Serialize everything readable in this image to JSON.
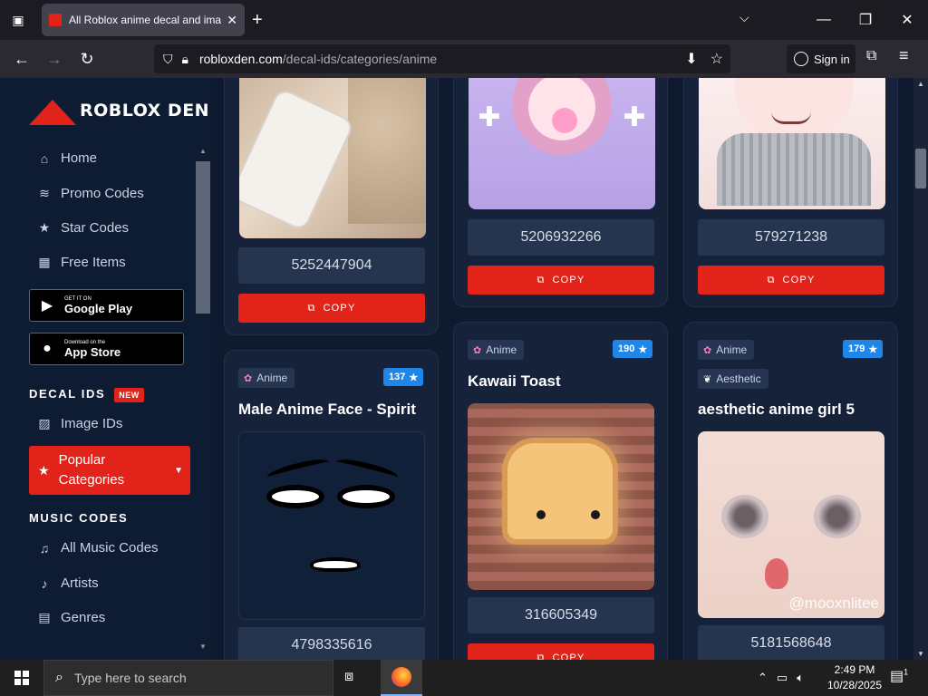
{
  "browser": {
    "tab_title": "All Roblox anime decal and ima",
    "url_domain": "robloxden.com",
    "url_path": "/decal-ids/categories/anime",
    "signin_label": "Sign in"
  },
  "sidebar": {
    "logo_text": "ROBLOX DEN",
    "items": [
      {
        "label": "Home",
        "icon": "home-icon"
      },
      {
        "label": "Promo Codes",
        "icon": "coins-icon"
      },
      {
        "label": "Star Codes",
        "icon": "star-icon"
      },
      {
        "label": "Free Items",
        "icon": "items-icon"
      }
    ],
    "google_play": {
      "small": "GET IT ON",
      "big": "Google Play"
    },
    "app_store": {
      "small": "Download on the",
      "big": "App Store"
    },
    "decal_heading": "DECAL IDS",
    "new_badge": "NEW",
    "image_ids": "Image IDs",
    "popular_categories": "Popular Categories",
    "music_heading": "MUSIC CODES",
    "music_items": [
      {
        "label": "All Music Codes",
        "icon": "music-icon"
      },
      {
        "label": "Artists",
        "icon": "artists-icon"
      },
      {
        "label": "Genres",
        "icon": "genres-icon"
      }
    ]
  },
  "cards": [
    {
      "id": "5252447904",
      "copy": "COPY"
    },
    {
      "id": "5206932266",
      "copy": "COPY"
    },
    {
      "id": "579271238",
      "copy": "COPY"
    },
    {
      "tag": "Anime",
      "likes": "137",
      "title": "Male Anime Face - Spirit",
      "id": "4798335616"
    },
    {
      "tag": "Anime",
      "likes": "190",
      "title": "Kawaii Toast",
      "id": "316605349",
      "copy": "COPY"
    },
    {
      "tag": "Anime",
      "tag2": "Aesthetic",
      "likes": "179",
      "title": "aesthetic anime girl 5",
      "id": "5181568648",
      "watermark": "@mooxnlitee"
    }
  ],
  "taskbar": {
    "search_placeholder": "Type here to search",
    "time": "2:49 PM",
    "date": "10/28/2025",
    "notifications": "1"
  },
  "colors": {
    "accent_red": "#e2231a",
    "likes_blue": "#1f86e8",
    "bg": "#0f1a2e"
  }
}
